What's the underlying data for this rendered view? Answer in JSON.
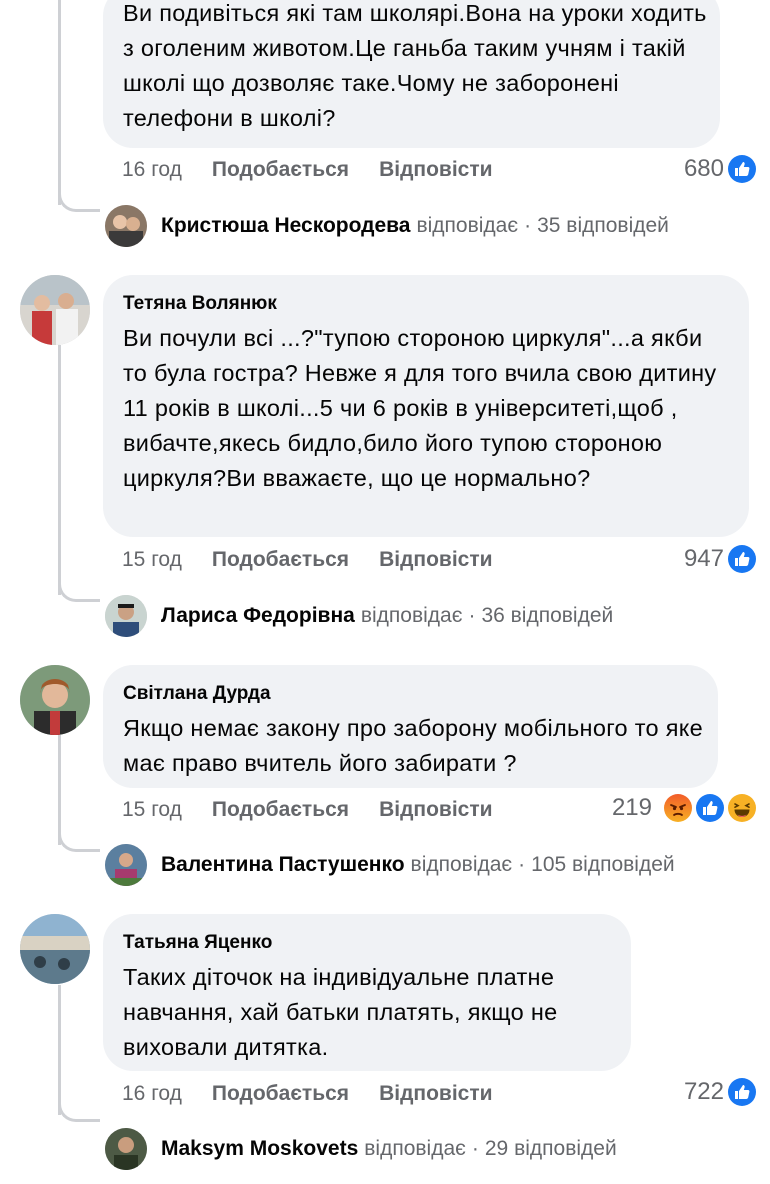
{
  "comments": [
    {
      "author": "",
      "text": "Ви подивіться які там школярі.Вона на уроки ходить з оголеним животом.Це ганьба таким учням і такій школі що дозволяє таке.Чому не заборонені телефони в школі?",
      "time": "16 год",
      "like_label": "Подобається",
      "reply_label": "Відповісти",
      "reactions_count": "680",
      "reactions": [
        "like-icon"
      ],
      "reply_author": "Кристюша Нескородева",
      "reply_verb": "відповідає",
      "reply_count": "35 відповідей"
    },
    {
      "author": "Тетяна Волянюк",
      "text": "Ви почули всі ...?\"тупою стороною циркуля\"...а якби то була гостра? Невже я для того вчила свою дитину 11 років в школі...5 чи 6 років в університеті,щоб , вибачте,якесь бидло,било його тупою стороною циркуля?Ви вважаєте, що це нормально?",
      "time": "15 год",
      "like_label": "Подобається",
      "reply_label": "Відповісти",
      "reactions_count": "947",
      "reactions": [
        "like-icon"
      ],
      "reply_author": "Лариса Федорівна",
      "reply_verb": "відповідає",
      "reply_count": "36 відповідей"
    },
    {
      "author": "Світлана Дурда",
      "text": "Якщо немає закону про заборону мобільного то яке має право вчитель його забирати ?",
      "time": "15 год",
      "like_label": "Подобається",
      "reply_label": "Відповісти",
      "reactions_count": "219",
      "reactions": [
        "angry-icon",
        "like-icon",
        "haha-icon"
      ],
      "reply_author": "Валентина Пастушенко",
      "reply_verb": "відповідає",
      "reply_count": "105 відповідей"
    },
    {
      "author": "Татьяна Яценко",
      "text": "Таких діточок на індивідуальне платне навчання, хай батьки платять, якщо не виховали дитятка.",
      "time": "16 год",
      "like_label": "Подобається",
      "reply_label": "Відповісти",
      "reactions_count": "722",
      "reactions": [
        "like-icon"
      ],
      "reply_author": "Maksym Moskovets",
      "reply_verb": "відповідає",
      "reply_count": "29 відповідей"
    }
  ],
  "colors": {
    "bubble": "#f0f2f5",
    "meta": "#65676b",
    "like_blue": "#1877f2",
    "angry_red": "#e9573e",
    "haha_yellow": "#f7b125"
  }
}
